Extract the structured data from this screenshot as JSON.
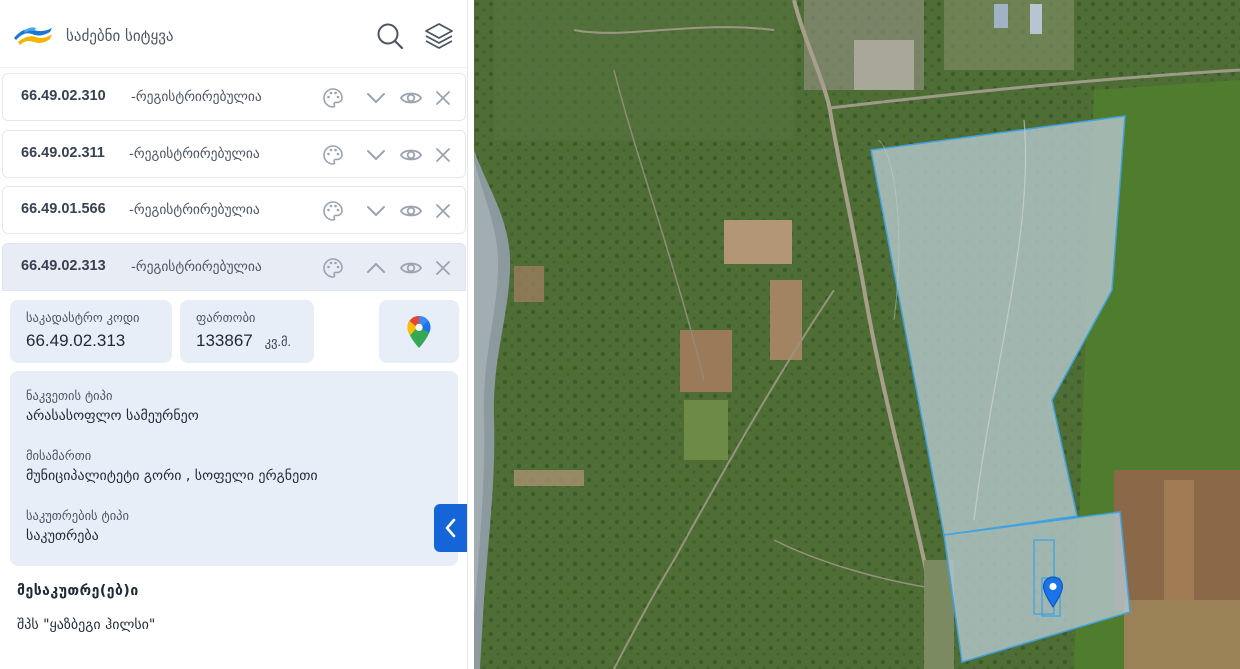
{
  "search": {
    "placeholder": "საძებნი სიტყვა"
  },
  "icons": {
    "search": "search-icon",
    "layers": "layers-icon",
    "palette": "palette-icon",
    "chevron_down": "chevron-down-icon",
    "chevron_up": "chevron-up-icon",
    "eye": "eye-icon",
    "close": "close-icon",
    "maps": "google-maps-pin-icon",
    "collapse": "chevron-left-icon"
  },
  "parcels": [
    {
      "code": "66.49.02.310",
      "status": "-რეგისტრირებულია",
      "expanded": false
    },
    {
      "code": "66.49.02.311",
      "status": "-რეგისტრირებულია",
      "expanded": false
    },
    {
      "code": "66.49.01.566",
      "status": "-რეგისტრირებულია",
      "expanded": false
    },
    {
      "code": "66.49.02.313",
      "status": "-რეგისტრირებულია",
      "expanded": true
    }
  ],
  "details": {
    "cadastral_label": "საკადასტრო კოდი",
    "cadastral_value": "66.49.02.313",
    "area_label": "ფართობი",
    "area_value": "133867",
    "area_unit": "კვ.მ.",
    "land_type_label": "ნაკვეთის ტიპი",
    "land_type_value": "არასასოფლო სამეურნეო",
    "address_label": "მისამართი",
    "address_value": "მუნიციპალიტეტი გორი , სოფელი ერგნეთი",
    "ownership_label": "საკუთრების ტიპი",
    "ownership_value": "საკუთრება",
    "owners_title": "მესაკუთრე(ებ)ი",
    "owner_name": "შპს \"ყაზბეგი ჰილსი\""
  },
  "colors": {
    "accent": "#1565d8",
    "card_bg": "#e8eef7",
    "parcel_outline": "#3fa3e0"
  }
}
